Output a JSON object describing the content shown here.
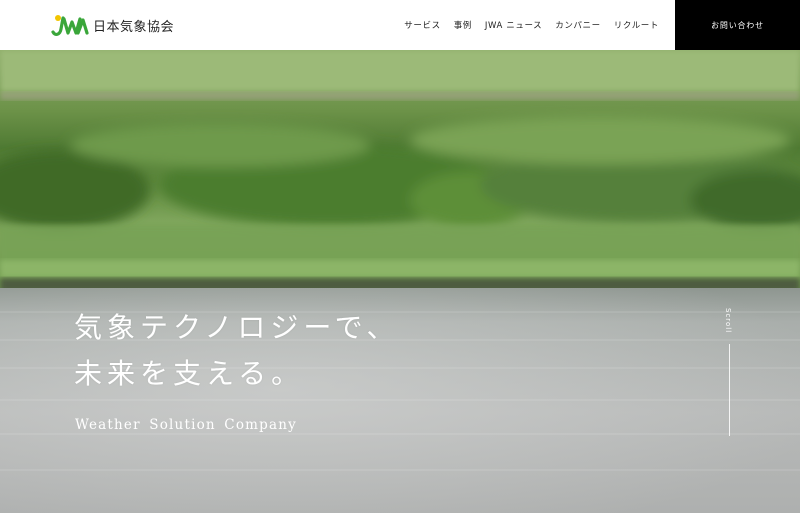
{
  "brand": {
    "mark_text": "JWA",
    "name": "日本気象協会",
    "mark_color": "#3aa63a",
    "mark_accent": "#f2c500"
  },
  "nav": {
    "items": [
      "サービス",
      "事例",
      "JWA ニュース",
      "カンパニー",
      "リクルート"
    ],
    "contact": "お問い合わせ"
  },
  "hero": {
    "title_line1": "気象テクノロジーで、",
    "title_line2": "未来を支える。",
    "subtitle": "Weather Solution Company",
    "scroll_label": "Scroll"
  },
  "colors": {
    "header_bg": "#ffffff",
    "contact_bg": "#000000",
    "text": "#222222"
  }
}
